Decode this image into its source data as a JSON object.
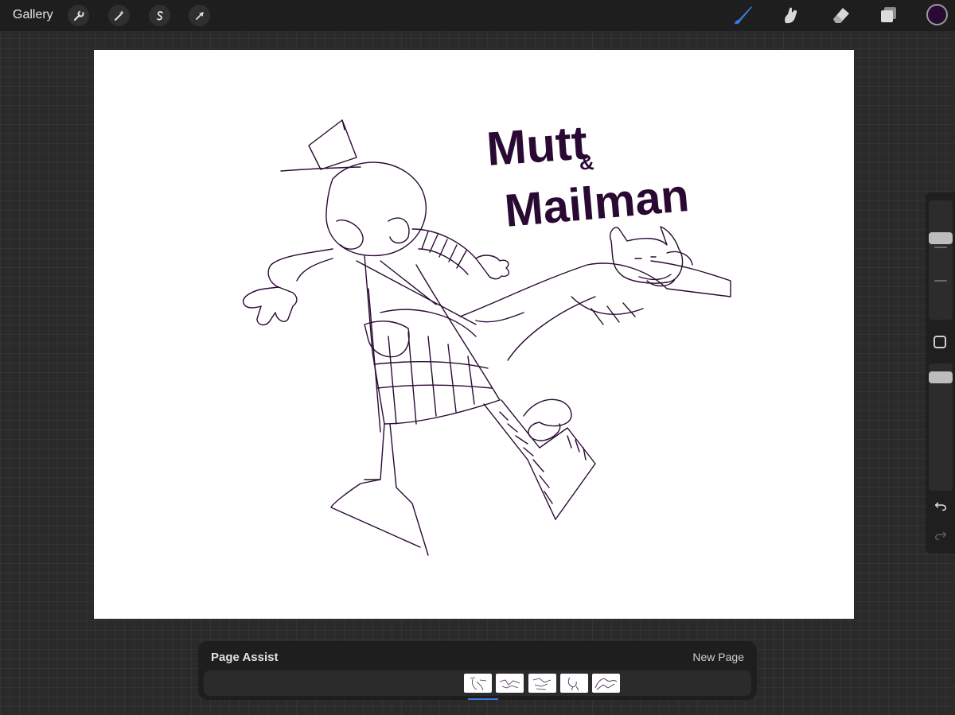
{
  "app": "Procreate",
  "topbar": {
    "gallery_label": "Gallery",
    "left_tools": [
      {
        "name": "actions-wrench-icon"
      },
      {
        "name": "adjustments-wand-icon"
      },
      {
        "name": "selection-s-icon"
      },
      {
        "name": "transform-arrow-icon"
      }
    ],
    "right_tools": [
      {
        "name": "brush-icon",
        "active": true
      },
      {
        "name": "smudge-icon"
      },
      {
        "name": "eraser-icon"
      },
      {
        "name": "layers-icon"
      }
    ],
    "current_color": "#2a0a33"
  },
  "colors": {
    "accent": "#3a78e0",
    "ink": "#2a0a33"
  },
  "canvas": {
    "lettering": [
      "Mutt",
      "&",
      "Mailman"
    ]
  },
  "page_assist": {
    "title": "Page Assist",
    "new_page_label": "New Page",
    "pages": [
      {
        "index": 1,
        "selected": true
      },
      {
        "index": 2,
        "selected": false
      },
      {
        "index": 3,
        "selected": false
      },
      {
        "index": 4,
        "selected": false
      },
      {
        "index": 5,
        "selected": false
      }
    ]
  }
}
